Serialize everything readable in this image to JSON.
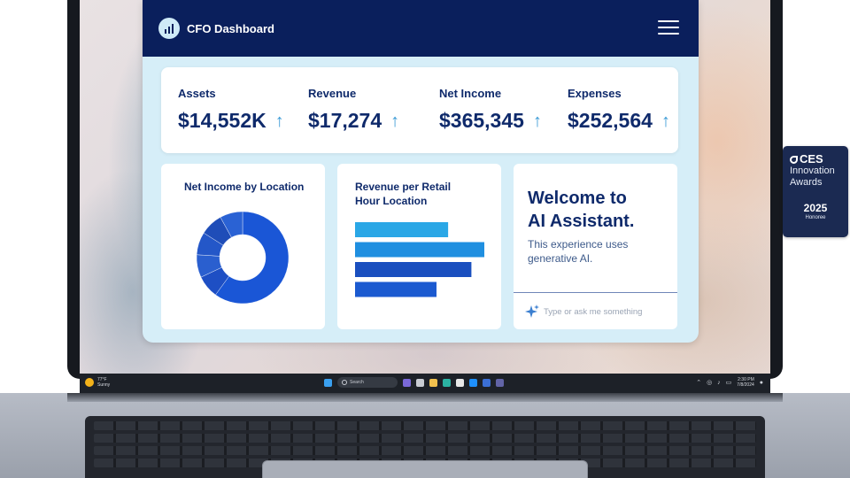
{
  "app": {
    "title": "CFO Dashboard",
    "menu_icon": "hamburger-menu-icon",
    "logo_icon": "chart-logo-icon"
  },
  "kpis": [
    {
      "label": "Assets",
      "value": "$14,552K",
      "trend": "up"
    },
    {
      "label": "Revenue",
      "value": "$17,274",
      "trend": "up"
    },
    {
      "label": "Net Income",
      "value": "$365,345",
      "trend": "up"
    },
    {
      "label": "Expenses",
      "value": "$252,564",
      "trend": "up"
    }
  ],
  "net_income_card": {
    "title": "Net Income by Location"
  },
  "revenue_card": {
    "title_line1": "Revenue per Retail",
    "title_line2": "Hour Location"
  },
  "assistant": {
    "title_line1": "Welcome to",
    "title_line2": "AI Assistant.",
    "subtitle_line1": "This experience uses",
    "subtitle_line2": "generative AI.",
    "input_placeholder": "Type or ask me something"
  },
  "taskbar": {
    "weather_temp": "77°F",
    "weather_desc": "Sunny",
    "search_placeholder": "Search",
    "time": "2:30 PM",
    "date": "7/8/2024"
  },
  "badge": {
    "brand": "CES",
    "line1": "Innovation",
    "line2": "Awards",
    "year": "2025",
    "honoree": "Honoree"
  },
  "chart_data": [
    {
      "type": "pie",
      "values": [
        60,
        8,
        8,
        8,
        8,
        8
      ],
      "colors": [
        "#1a56d6",
        "#1e4fc4",
        "#2a5fcf",
        "#2457c8",
        "#1f4db8",
        "#2a62d4"
      ]
    },
    {
      "type": "bar",
      "orientation": "horizontal",
      "values": [
        72,
        100,
        90,
        63
      ],
      "colors": [
        "#2aa7e6",
        "#1f8fe0",
        "#1a4fbf",
        "#1b5ad0"
      ]
    }
  ],
  "colors": {
    "header": "#0a1f5c",
    "panel": "#d6eef8",
    "text_primary": "#0f2a6b",
    "accent": "#3b9bd6"
  }
}
